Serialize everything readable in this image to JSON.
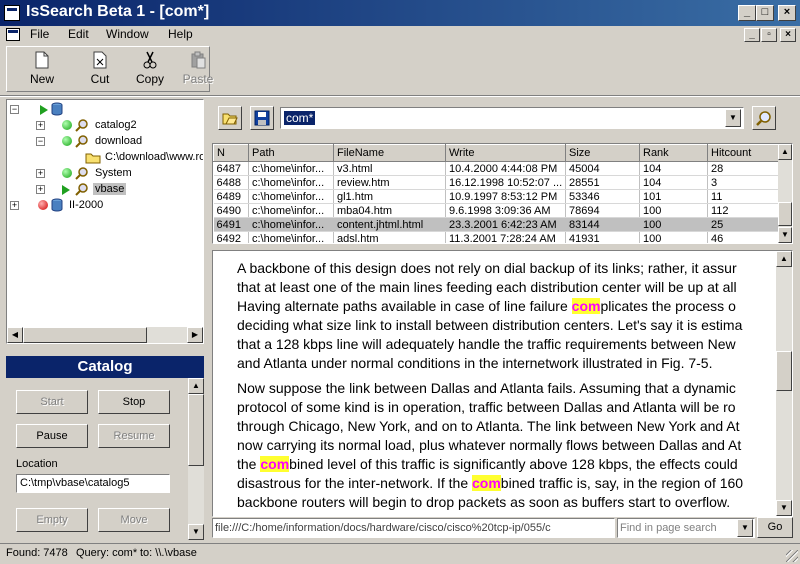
{
  "window": {
    "title": "IsSearch Beta 1 - [com*]",
    "controls": {
      "minimize": "_",
      "maximize": "□",
      "close": "×"
    }
  },
  "menu": [
    "File",
    "Edit",
    "Window",
    "Help"
  ],
  "toolbar": {
    "new_label": "New",
    "cut_label": "Cut",
    "copy_label": "Copy",
    "paste_label": "Paste"
  },
  "tree": {
    "nodes": [
      {
        "label": "catalog2"
      },
      {
        "label": "download"
      },
      {
        "label": "C:\\download\\www.ro"
      },
      {
        "label": "System"
      },
      {
        "label": "vbase"
      },
      {
        "label": "II-2000"
      }
    ]
  },
  "catalog": {
    "title": "Catalog",
    "buttons": {
      "start": "Start",
      "stop": "Stop",
      "pause": "Pause",
      "resume": "Resume",
      "empty": "Empty",
      "move": "Move"
    },
    "location_label": "Location",
    "location_value": "C:\\tmp\\vbase\\catalog5"
  },
  "search": {
    "query": "com*"
  },
  "results": {
    "columns": [
      "N",
      "Path",
      "FileName",
      "Write",
      "Size",
      "Rank",
      "Hitcount"
    ],
    "rows": [
      [
        "6487",
        "c:\\home\\infor...",
        "v3.html",
        "10.4.2000 4:44:08 PM",
        "45004",
        "104",
        "28"
      ],
      [
        "6488",
        "c:\\home\\infor...",
        "review.htm",
        "16.12.1998 10:52:07 ...",
        "28551",
        "104",
        "3"
      ],
      [
        "6489",
        "c:\\home\\infor...",
        "gl1.htm",
        "10.9.1997 8:53:12 PM",
        "53346",
        "101",
        "11"
      ],
      [
        "6490",
        "c:\\home\\infor...",
        "mba04.htm",
        "9.6.1998 3:09:36 AM",
        "78694",
        "100",
        "112"
      ],
      [
        "6491",
        "c:\\home\\infor...",
        "content.jhtml.html",
        "23.3.2001 6:42:23 AM",
        "83144",
        "100",
        "25"
      ],
      [
        "6492",
        "c:\\home\\infor...",
        "adsl.htm",
        "11.3.2001 7:28:24 AM",
        "41931",
        "100",
        "46"
      ]
    ],
    "selected_row": 4
  },
  "viewer": {
    "p1": {
      "l1": "A backbone of this design does not rely on dial backup of its links; rather, it assur",
      "l2": "that at least one of the main lines feeding each distribution center will be up at all",
      "l3_pre": "Having alternate paths available in case of line failure ",
      "l3_hl": "com",
      "l3_post": "plicates the process o",
      "l4": "deciding what size link to install between distribution centers. Let's say it is estima",
      "l5": "that a 128 kbps line will adequately handle the traffic requirements between New",
      "l6": "and Atlanta under normal conditions in the internetwork illustrated in Fig. 7-5."
    },
    "p2": {
      "l1": "Now suppose the link between Dallas and Atlanta fails. Assuming that a dynamic",
      "l2": "protocol of some kind is in operation, traffic between Dallas and Atlanta will be ro",
      "l3": "through Chicago, New York, and on to Atlanta. The link between New York and At",
      "l4": "now carrying its normal load, plus whatever normally flows between Dallas and At",
      "l5_pre": "the ",
      "l5_hl": "com",
      "l5_post": "bined level of this traffic is significantly above 128 kbps, the effects could",
      "l6_pre": "disastrous for the inter-network. If the ",
      "l6_hl": "com",
      "l6_post": "bined traffic is, say, in the region of 160",
      "l7": "backbone routers will begin to drop packets as soon as buffers start to overflow."
    }
  },
  "urlbar": {
    "value": "file:///C:/home/information/docs/hardware/cisco/cisco%20tcp-ip/055/c"
  },
  "find": {
    "placeholder": "Find in page search",
    "go_label": "Go"
  },
  "status": {
    "found": "Found: 7478",
    "query": "Query: com*",
    "to": "to: \\\\.\\vbase"
  },
  "colors": {
    "titlebar": "#0a246a",
    "highlight_bg": "#ffff30",
    "highlight_fg": "#ff00ff"
  }
}
